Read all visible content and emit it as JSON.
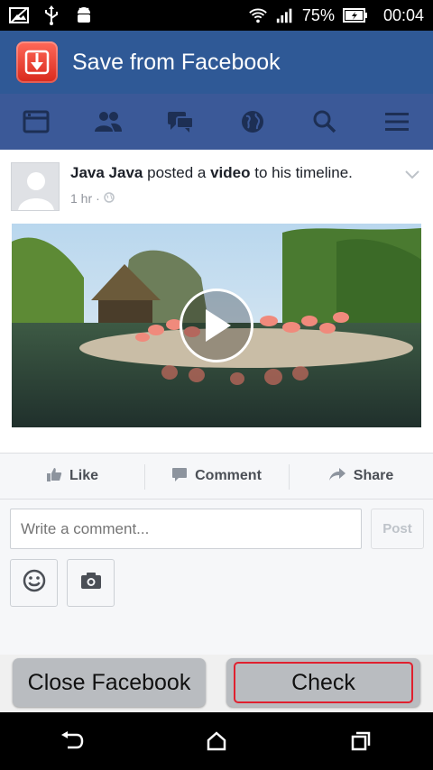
{
  "status_bar": {
    "battery_percent": "75%",
    "time": "00:04",
    "left_icons": [
      "image-icon",
      "usb-icon",
      "android-icon"
    ],
    "right_icons": [
      "wifi-icon",
      "signal-icon",
      "battery-icon"
    ]
  },
  "app_bar": {
    "title": "Save from Facebook",
    "logo_icon": "download-icon",
    "color": "#2f5996"
  },
  "fb_nav": {
    "color": "#3b5998",
    "items": [
      {
        "icon": "news-feed-icon"
      },
      {
        "icon": "friends-icon"
      },
      {
        "icon": "messages-icon"
      },
      {
        "icon": "globe-icon"
      },
      {
        "icon": "search-icon"
      },
      {
        "icon": "menu-icon"
      }
    ]
  },
  "post": {
    "author": "Java Java",
    "text_posted": "posted a",
    "text_object": "video",
    "text_rest": "to his timeline.",
    "time": "1 hr",
    "time_sep": "·"
  },
  "actions": {
    "like": "Like",
    "comment": "Comment",
    "share": "Share"
  },
  "comment_box": {
    "placeholder": "Write a comment...",
    "post_label": "Post"
  },
  "bottom": {
    "close_label": "Close Facebook",
    "check_label": "Check",
    "check_border_color": "#e0202f"
  }
}
